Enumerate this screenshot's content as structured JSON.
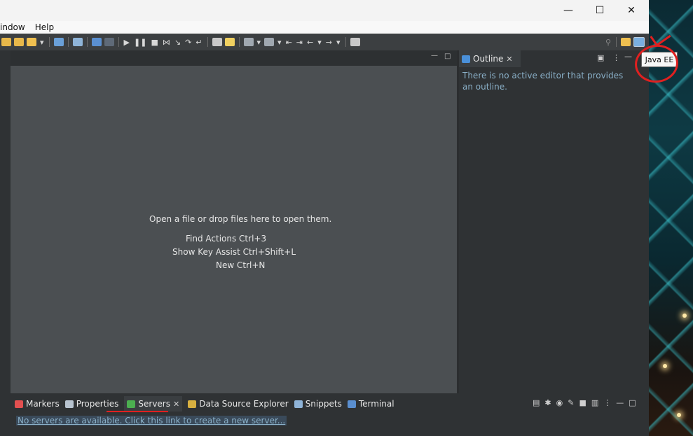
{
  "menu": {
    "window": "indow",
    "help": "Help"
  },
  "window_controls": {
    "minimize": "—",
    "maximize": "☐",
    "close": "✕"
  },
  "editor": {
    "open_hint": "Open a file or drop files here to open them.",
    "find_actions": "Find Actions Ctrl+3",
    "show_key_assist": "Show Key Assist Ctrl+Shift+L",
    "new": "New Ctrl+N"
  },
  "outline": {
    "tab_label": "Outline",
    "message": "There is no active editor that provides an outline."
  },
  "perspective": {
    "tooltip": "Java EE"
  },
  "bottom_tabs": [
    {
      "label": "Markers"
    },
    {
      "label": "Properties"
    },
    {
      "label": "Servers"
    },
    {
      "label": "Data Source Explorer"
    },
    {
      "label": "Snippets"
    },
    {
      "label": "Terminal"
    }
  ],
  "servers": {
    "link": "No servers are available. Click this link to create a new server..."
  },
  "colors": {
    "editor_bg": "#4b4f52",
    "panel_bg": "#2f3234",
    "annotation": "#e02020",
    "link": "#8ab0c8"
  }
}
